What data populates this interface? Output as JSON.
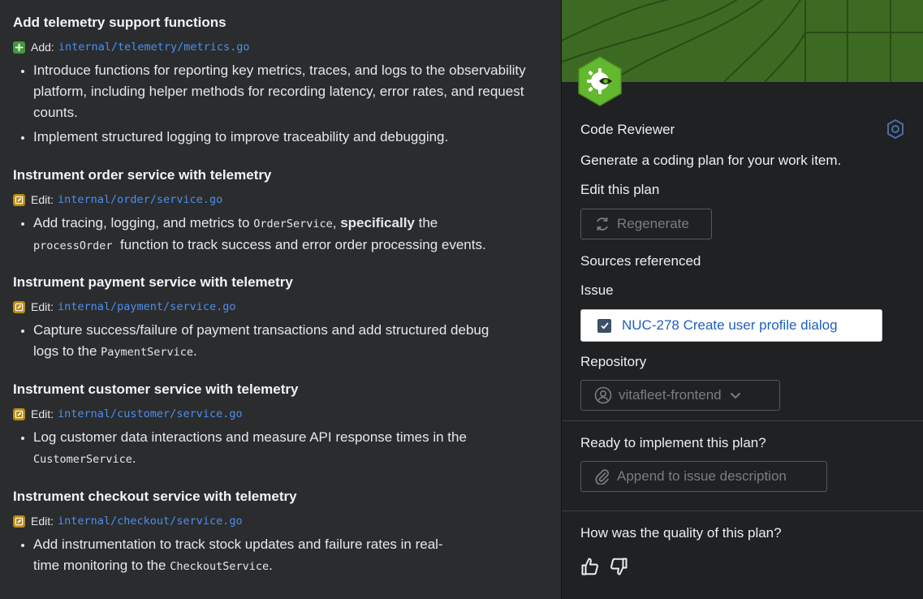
{
  "plan": {
    "sections": [
      {
        "title": "Add telemetry support functions",
        "action": "Add:",
        "action_type": "add",
        "path": "internal/telemetry/metrics.go",
        "bullets": [
          "Introduce functions for reporting key metrics, traces, and logs to the observability platform, including helper methods for recording latency, error rates, and request counts.",
          "Implement structured logging to improve traceability and debugging."
        ]
      },
      {
        "title": "Instrument order service with telemetry",
        "action": "Edit:",
        "action_type": "edit",
        "path": "internal/order/service.go",
        "bullet_parts": [
          "Add tracing, logging, and metrics to ",
          "OrderService",
          ", ",
          "specifically",
          " the ",
          "processOrder",
          "  function to track success and error order processing events."
        ]
      },
      {
        "title": "Instrument payment service with telemetry",
        "action": "Edit:",
        "action_type": "edit",
        "path": "internal/payment/service.go",
        "bullet_parts": [
          "Capture success/failure of payment transactions and add structured debug logs to the ",
          "PaymentService",
          "."
        ]
      },
      {
        "title": "Instrument customer service with telemetry",
        "action": "Edit:",
        "action_type": "edit",
        "path": "internal/customer/service.go",
        "bullet_parts": [
          "Log customer data interactions and measure API response times in the ",
          "CustomerService",
          "."
        ]
      },
      {
        "title": "Instrument checkout service with telemetry",
        "action": "Edit:",
        "action_type": "edit",
        "path": "internal/checkout/service.go",
        "bullet_parts": [
          "Add instrumentation to track stock updates and failure rates in real-time monitoring to the ",
          "CheckoutService",
          "."
        ]
      }
    ]
  },
  "sidebar": {
    "agent_name": "Code Reviewer",
    "description": "Generate a coding plan for your work item.",
    "edit_heading": "Edit this plan",
    "regenerate_label": "Regenerate",
    "sources_heading": "Sources referenced",
    "issue_heading": "Issue",
    "issue_label": "NUC-278 Create user profile dialog",
    "repository_heading": "Repository",
    "repository_value": "vitafleet-frontend",
    "ready_heading": "Ready to implement this plan?",
    "append_label": "Append to issue description",
    "quality_heading": "How was the quality of this plan?"
  },
  "icons": {
    "add": "plus-icon",
    "edit": "pencil-edit-icon",
    "gear": "hexagon-settings-icon",
    "regenerate": "refresh-icon",
    "issue": "checkbox-icon",
    "repository": "user-avatar-icon",
    "dropdown": "chevron-down-icon",
    "append": "paperclip-icon",
    "like": "thumbs-up-icon",
    "dislike": "thumbs-down-icon",
    "agent": "agent-hexagon-eye-icon"
  },
  "colors": {
    "path_link": "#4b8ff0",
    "add_badge": "#3f9a3a",
    "edit_badge": "#b98a12",
    "banner": "#3c6a22",
    "agent_hex": "#63b82e"
  }
}
